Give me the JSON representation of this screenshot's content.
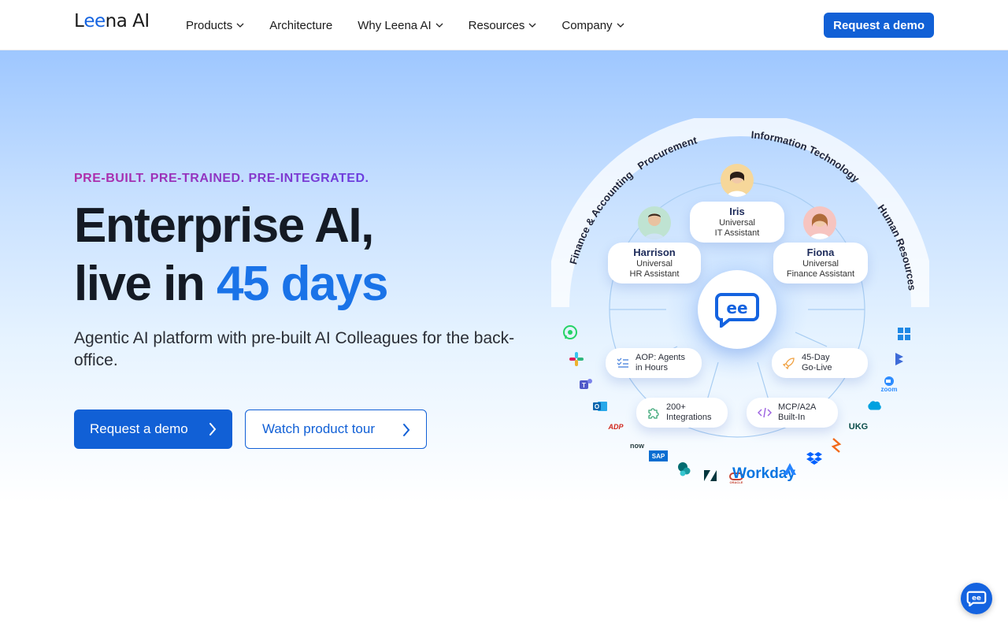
{
  "nav": {
    "logo_text_1": "L",
    "logo_text_ee": "ee",
    "logo_text_2": "na AI",
    "items": [
      {
        "label": "Products",
        "has_dropdown": true
      },
      {
        "label": "Architecture",
        "has_dropdown": false
      },
      {
        "label": "Why Leena AI",
        "has_dropdown": true
      },
      {
        "label": "Resources",
        "has_dropdown": true
      },
      {
        "label": "Company",
        "has_dropdown": true
      }
    ],
    "cta_label": "Request a demo"
  },
  "hero": {
    "eyebrow": "PRE-BUILT. PRE-TRAINED. PRE-INTEGRATED.",
    "title_line1": "Enterprise AI,",
    "title_line2_prefix": "live in ",
    "title_line2_accent": "45 days",
    "subtitle": "Agentic AI platform with pre-built AI Colleagues for the back-office.",
    "primary_cta": "Request a demo",
    "secondary_cta": "Watch product tour"
  },
  "diagram": {
    "arc_labels": [
      "Finance & Accounting",
      "Procurement",
      "Information Technology",
      "Human Resources"
    ],
    "assistants": [
      {
        "name": "Iris",
        "line1": "Universal",
        "line2": "IT Assistant"
      },
      {
        "name": "Harrison",
        "line1": "Universal",
        "line2": "HR Assistant"
      },
      {
        "name": "Fiona",
        "line1": "Universal",
        "line2": "Finance Assistant"
      }
    ],
    "features": [
      {
        "line1": "AOP: Agents",
        "line2": "in Hours",
        "icon": "checklist-icon"
      },
      {
        "line1": "45-Day",
        "line2": "Go-Live",
        "icon": "rocket-icon"
      },
      {
        "line1": "200+",
        "line2": "Integrations",
        "icon": "puzzle-icon"
      },
      {
        "line1": "MCP/A2A",
        "line2": "Built-In",
        "icon": "code-icon"
      }
    ],
    "integrations": [
      "WhatsApp",
      "Slack",
      "Teams",
      "Outlook",
      "ADP",
      "now",
      "SAP",
      "SharePoint",
      "Zendesk",
      "ORACLE",
      "Workday",
      "Atlassian",
      "Dropbox",
      "BambooHR",
      "UKG",
      "Salesforce",
      "zoom",
      "Dynamics",
      "Windows"
    ]
  },
  "colors": {
    "brand_blue": "#1160d6",
    "accent_blue": "#1a73e8",
    "eyebrow_start": "#b12ca8",
    "eyebrow_end": "#6a3fe0"
  }
}
